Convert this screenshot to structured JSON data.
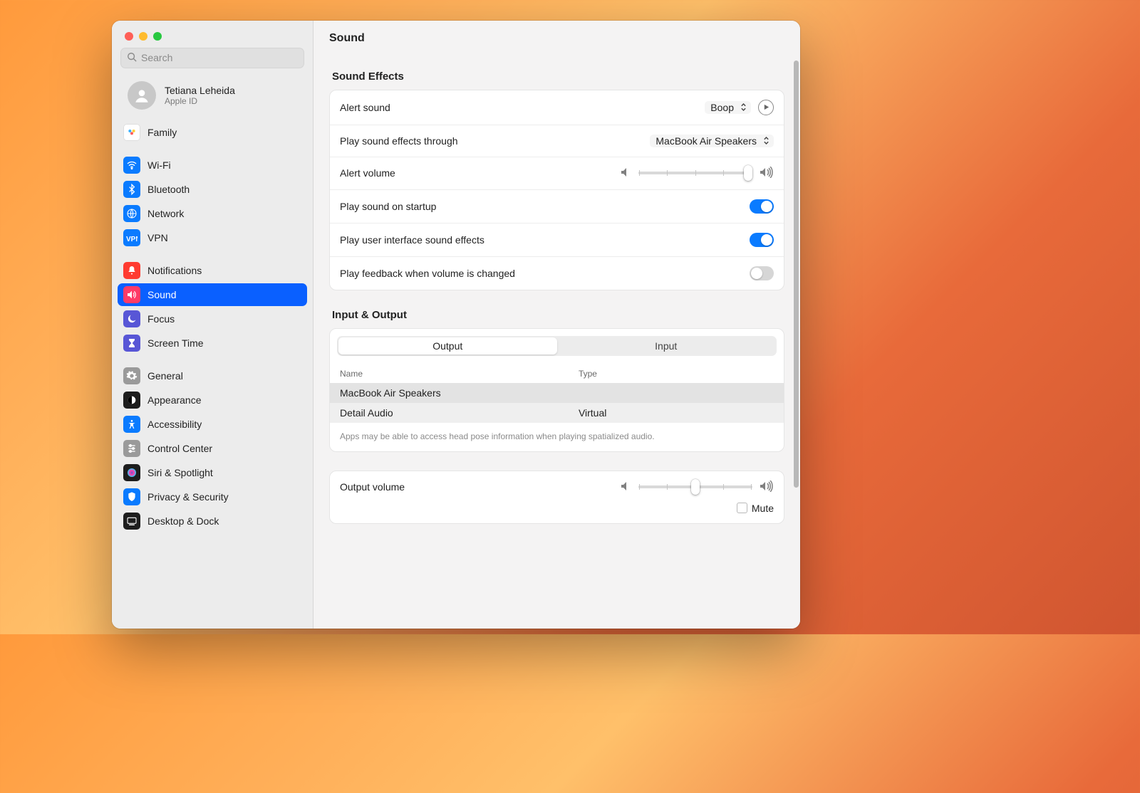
{
  "search": {
    "placeholder": "Search"
  },
  "account": {
    "name": "Tetiana Leheida",
    "sub": "Apple ID"
  },
  "sidebar": {
    "groups": [
      [
        {
          "label": "Family",
          "icon": "family",
          "bg": "#ffffff"
        }
      ],
      [
        {
          "label": "Wi-Fi",
          "icon": "wifi",
          "bg": "#0a7bff"
        },
        {
          "label": "Bluetooth",
          "icon": "bluetooth",
          "bg": "#0a7bff"
        },
        {
          "label": "Network",
          "icon": "globe",
          "bg": "#0a7bff"
        },
        {
          "label": "VPN",
          "icon": "vpn",
          "bg": "#0a7bff"
        }
      ],
      [
        {
          "label": "Notifications",
          "icon": "bell",
          "bg": "#ff3b30"
        },
        {
          "label": "Sound",
          "icon": "speaker",
          "bg": "#ff3b67",
          "selected": true
        },
        {
          "label": "Focus",
          "icon": "moon",
          "bg": "#5856d6"
        },
        {
          "label": "Screen Time",
          "icon": "hourglass",
          "bg": "#5856d6"
        }
      ],
      [
        {
          "label": "General",
          "icon": "gear",
          "bg": "#9a9a9a"
        },
        {
          "label": "Appearance",
          "icon": "appearance",
          "bg": "#1d1d1d"
        },
        {
          "label": "Accessibility",
          "icon": "access",
          "bg": "#0a7bff"
        },
        {
          "label": "Control Center",
          "icon": "sliders",
          "bg": "#9a9a9a"
        },
        {
          "label": "Siri & Spotlight",
          "icon": "siri",
          "bg": "#1d1d1d"
        },
        {
          "label": "Privacy & Security",
          "icon": "hand",
          "bg": "#0a7bff"
        },
        {
          "label": "Desktop & Dock",
          "icon": "dock",
          "bg": "#1d1d1d"
        }
      ]
    ]
  },
  "header": {
    "title": "Sound"
  },
  "effects": {
    "title": "Sound Effects",
    "alert_sound_label": "Alert sound",
    "alert_sound_value": "Boop",
    "play_through_label": "Play sound effects through",
    "play_through_value": "MacBook Air Speakers",
    "alert_volume_label": "Alert volume",
    "alert_volume_pct": 96,
    "startup_label": "Play sound on startup",
    "startup_on": true,
    "ui_sounds_label": "Play user interface sound effects",
    "ui_sounds_on": true,
    "feedback_label": "Play feedback when volume is changed",
    "feedback_on": false
  },
  "io": {
    "title": "Input & Output",
    "tabs": [
      "Output",
      "Input"
    ],
    "active_tab": "Output",
    "cols": {
      "name": "Name",
      "type": "Type"
    },
    "devices": [
      {
        "name": "MacBook Air Speakers",
        "type": ""
      },
      {
        "name": "Detail Audio",
        "type": "Virtual"
      }
    ],
    "note": "Apps may be able to access head pose information when playing spatialized audio.",
    "out_vol_label": "Output volume",
    "out_vol_pct": 50,
    "mute_label": "Mute"
  }
}
